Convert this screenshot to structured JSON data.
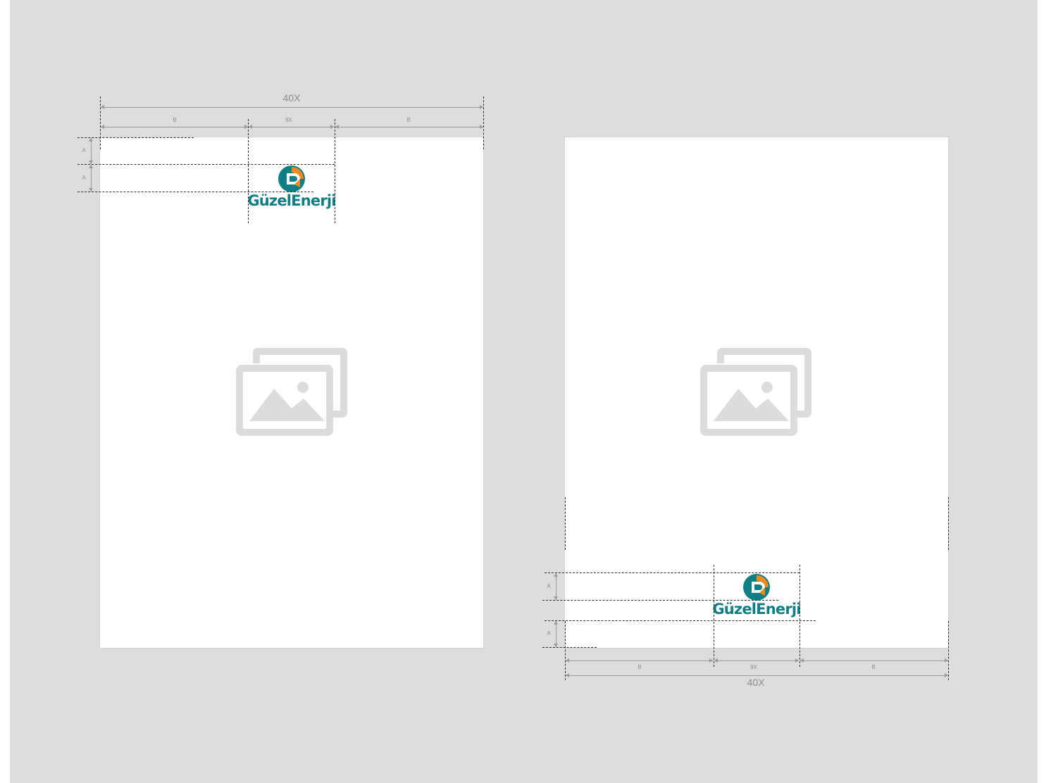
{
  "brand": {
    "name": "GüzelEnerji",
    "color_primary": "#0f7f86",
    "color_accent": "#ef8a1f"
  },
  "colors": {
    "background": "#dcdddf",
    "page": "#ffffff",
    "guide": "#2b2b2b",
    "dimension": "#9a9a9a",
    "placeholder": "#dcdcdc"
  },
  "layouts": [
    {
      "id": "logo-top",
      "total_label": "40X",
      "left_label": "B",
      "center_label": "9X",
      "right_label": "B",
      "margin_labels": [
        "A",
        "A"
      ],
      "placeholder_icon": "image-gallery-icon"
    },
    {
      "id": "logo-bottom",
      "total_label": "40X",
      "left_label": "B",
      "center_label": "9X",
      "right_label": "B",
      "margin_labels": [
        "A",
        "A"
      ],
      "placeholder_icon": "image-gallery-icon"
    }
  ]
}
